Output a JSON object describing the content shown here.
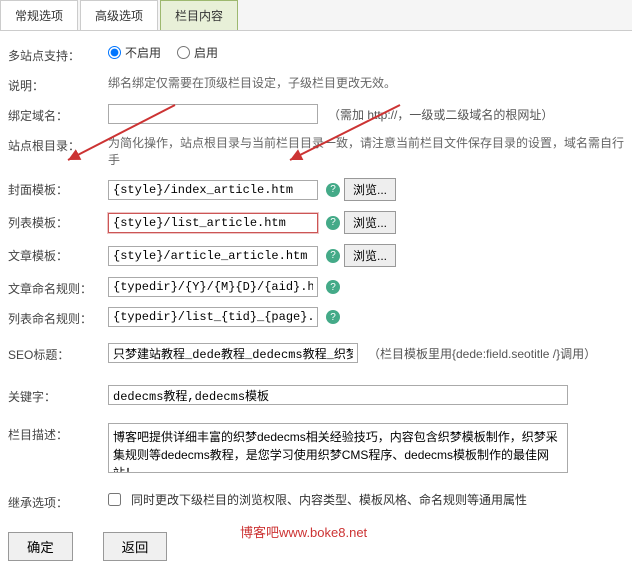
{
  "tabs": {
    "t1": "常规选项",
    "t2": "高级选项",
    "t3": "栏目内容"
  },
  "rows": {
    "multisite": {
      "label": "多站点支持：",
      "opt1": "不启用",
      "opt2": "启用"
    },
    "desc": {
      "label": "说明：",
      "text": "绑名绑定仅需要在顶级栏目设定，子级栏目更改无效。"
    },
    "binddomain": {
      "label": "绑定域名：",
      "hint": "（需加 http://，一级或二级域名的根网址）"
    },
    "siteroot": {
      "label": "站点根目录：",
      "text": "为简化操作，站点根目录与当前栏目目录一致，请注意当前栏目文件保存目录的设置，域名需自行手"
    },
    "covertpl": {
      "label": "封面模板：",
      "value": "{style}/index_article.htm",
      "btn": "浏览..."
    },
    "listtpl": {
      "label": "列表模板：",
      "value": "{style}/list_article.htm",
      "btn": "浏览..."
    },
    "arttpl": {
      "label": "文章模板：",
      "value": "{style}/article_article.htm",
      "btn": "浏览..."
    },
    "artrule": {
      "label": "文章命名规则：",
      "value": "{typedir}/{Y}/{M}{D}/{aid}.html"
    },
    "listrule": {
      "label": "列表命名规则：",
      "value": "{typedir}/list_{tid}_{page}.html"
    },
    "seotitle": {
      "label": "SEO标题：",
      "value": "只梦建站教程_dede教程_dedecms教程_织梦教程",
      "hint": "（栏目模板里用{dede:field.seotitle /}调用）"
    },
    "keywords": {
      "label": "关键字：",
      "value": "dedecms教程,dedecms模板"
    },
    "catdesc": {
      "label": "栏目描述：",
      "value": "博客吧提供详细丰富的织梦dedecms相关经验技巧，内容包含织梦模板制作，织梦采集规则等dedecms教程，是您学习使用织梦CMS程序、dedecms模板制作的最佳网站！"
    },
    "inherit": {
      "label": "继承选项：",
      "text": "同时更改下级栏目的浏览权限、内容类型、模板风格、命名规则等通用属性"
    }
  },
  "buttons": {
    "ok": "确定",
    "back": "返回"
  },
  "watermark": "博客吧www.boke8.net"
}
